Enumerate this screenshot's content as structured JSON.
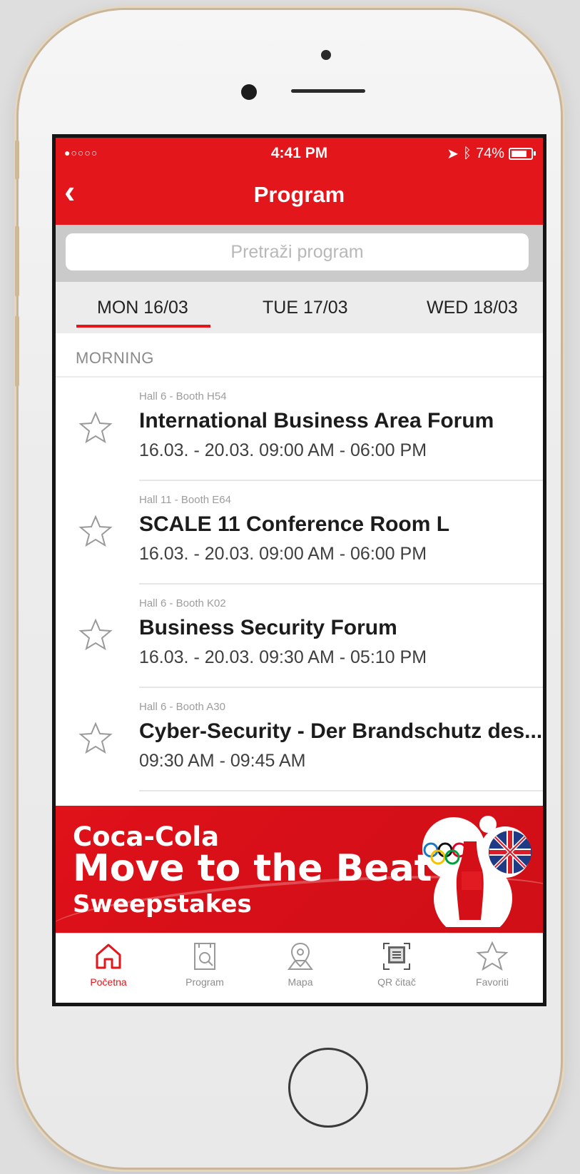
{
  "status_bar": {
    "signal": "●○○○○",
    "time": "4:41 PM",
    "battery": "74%",
    "location_icon": "location-arrow-icon",
    "bluetooth_icon": "bluetooth-icon"
  },
  "header": {
    "title": "Program",
    "back_icon": "back-chevron-icon"
  },
  "search": {
    "placeholder": "Pretraži program"
  },
  "days": [
    {
      "label": "MON 16/03",
      "selected": true
    },
    {
      "label": "TUE 17/03",
      "selected": false
    },
    {
      "label": "WED 18/03",
      "selected": false
    }
  ],
  "section": {
    "title": "MORNING"
  },
  "events": [
    {
      "location": "Hall 6 - Booth H54",
      "title": "International Business Area Forum",
      "time": "16.03. - 20.03. 09:00 AM - 06:00 PM"
    },
    {
      "location": "Hall 11 - Booth E64",
      "title": "SCALE 11 Conference Room L",
      "time": "16.03. - 20.03. 09:00 AM - 06:00 PM"
    },
    {
      "location": "Hall 6 - Booth K02",
      "title": "Business Security Forum",
      "time": "16.03. - 20.03. 09:30 AM - 05:10 PM"
    },
    {
      "location": "Hall 6 - Booth A30",
      "title": "Cyber-Security - Der Brandschutz des...",
      "time": "09:30 AM - 09:45 AM"
    }
  ],
  "ad": {
    "brand": "Coca-Cola",
    "headline": "Move to the Beat",
    "subline": "Sweepstakes"
  },
  "tabs": [
    {
      "label": "Početna",
      "icon": "home-icon",
      "active": true
    },
    {
      "label": "Program",
      "icon": "program-search-icon",
      "active": false
    },
    {
      "label": "Mapa",
      "icon": "map-pin-icon",
      "active": false
    },
    {
      "label": "QR čitač",
      "icon": "qr-code-icon",
      "active": false
    },
    {
      "label": "Favoriti",
      "icon": "star-icon",
      "active": false
    }
  ],
  "colors": {
    "accent": "#e3161b",
    "background": "#ffffff",
    "secondary_text": "#9d9d9d"
  }
}
